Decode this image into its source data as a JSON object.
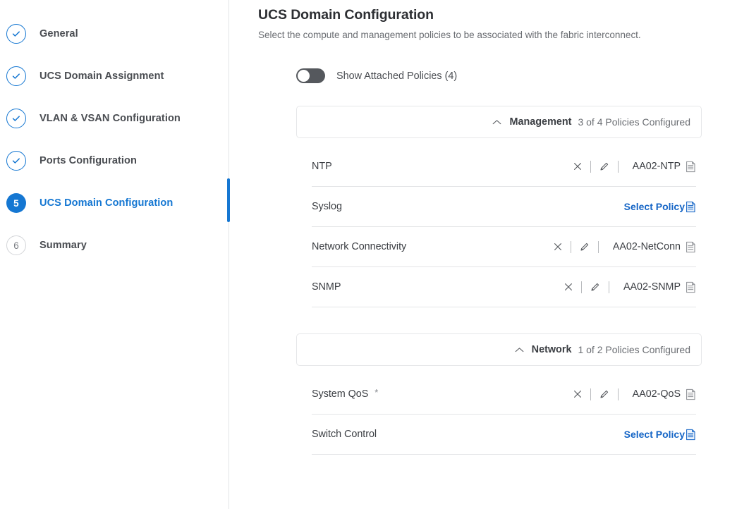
{
  "wizard": {
    "steps": [
      {
        "marker": "check-icon",
        "label": "General",
        "state": "done"
      },
      {
        "marker": "check-icon",
        "label": "UCS Domain Assignment",
        "state": "done"
      },
      {
        "marker": "check-icon",
        "label": "VLAN & VSAN Configuration",
        "state": "done"
      },
      {
        "marker": "check-icon",
        "label": "Ports Configuration",
        "state": "done"
      },
      {
        "marker": "5",
        "label": "UCS Domain Configuration",
        "state": "current"
      },
      {
        "marker": "6",
        "label": "Summary",
        "state": "pending"
      }
    ]
  },
  "header": {
    "title": "UCS Domain Configuration",
    "subtitle": "Select the compute and management policies to be associated with the fabric interconnect."
  },
  "toggle": {
    "label": "Show Attached Policies (4)",
    "state": "off"
  },
  "colors": {
    "accent": "#1577d2",
    "link": "#1565c6",
    "toggle_track": "#55588d",
    "text": "#3b3e43",
    "muted": "#6b6e73",
    "divider": "#e4e5e7"
  },
  "sections": [
    {
      "name": "Management",
      "status": "3 of 4 Policies Configured",
      "expanded": true,
      "chevron": "chevron-up-icon",
      "rows": [
        {
          "name": "NTP",
          "required": false,
          "configured": true,
          "value": "AA02-NTP",
          "clear_icon": "close-icon",
          "edit_icon": "pencil-icon",
          "doc_icon": "policy-list-icon"
        },
        {
          "name": "Syslog",
          "required": false,
          "configured": false,
          "select_label": "Select Policy",
          "doc_icon": "policy-list-icon"
        },
        {
          "name": "Network Connectivity",
          "required": false,
          "configured": true,
          "value": "AA02-NetConn",
          "clear_icon": "close-icon",
          "edit_icon": "pencil-icon",
          "doc_icon": "policy-list-icon"
        },
        {
          "name": "SNMP",
          "required": false,
          "configured": true,
          "value": "AA02-SNMP",
          "clear_icon": "close-icon",
          "edit_icon": "pencil-icon",
          "doc_icon": "policy-list-icon"
        }
      ]
    },
    {
      "name": "Network",
      "status": "1 of 2 Policies Configured",
      "expanded": true,
      "chevron": "chevron-up-icon",
      "rows": [
        {
          "name": "System QoS",
          "required": true,
          "required_mark": "*",
          "configured": true,
          "value": "AA02-QoS",
          "clear_icon": "close-icon",
          "edit_icon": "pencil-icon",
          "doc_icon": "policy-list-icon"
        },
        {
          "name": "Switch Control",
          "required": false,
          "configured": false,
          "select_label": "Select Policy",
          "doc_icon": "policy-list-icon"
        }
      ]
    }
  ]
}
